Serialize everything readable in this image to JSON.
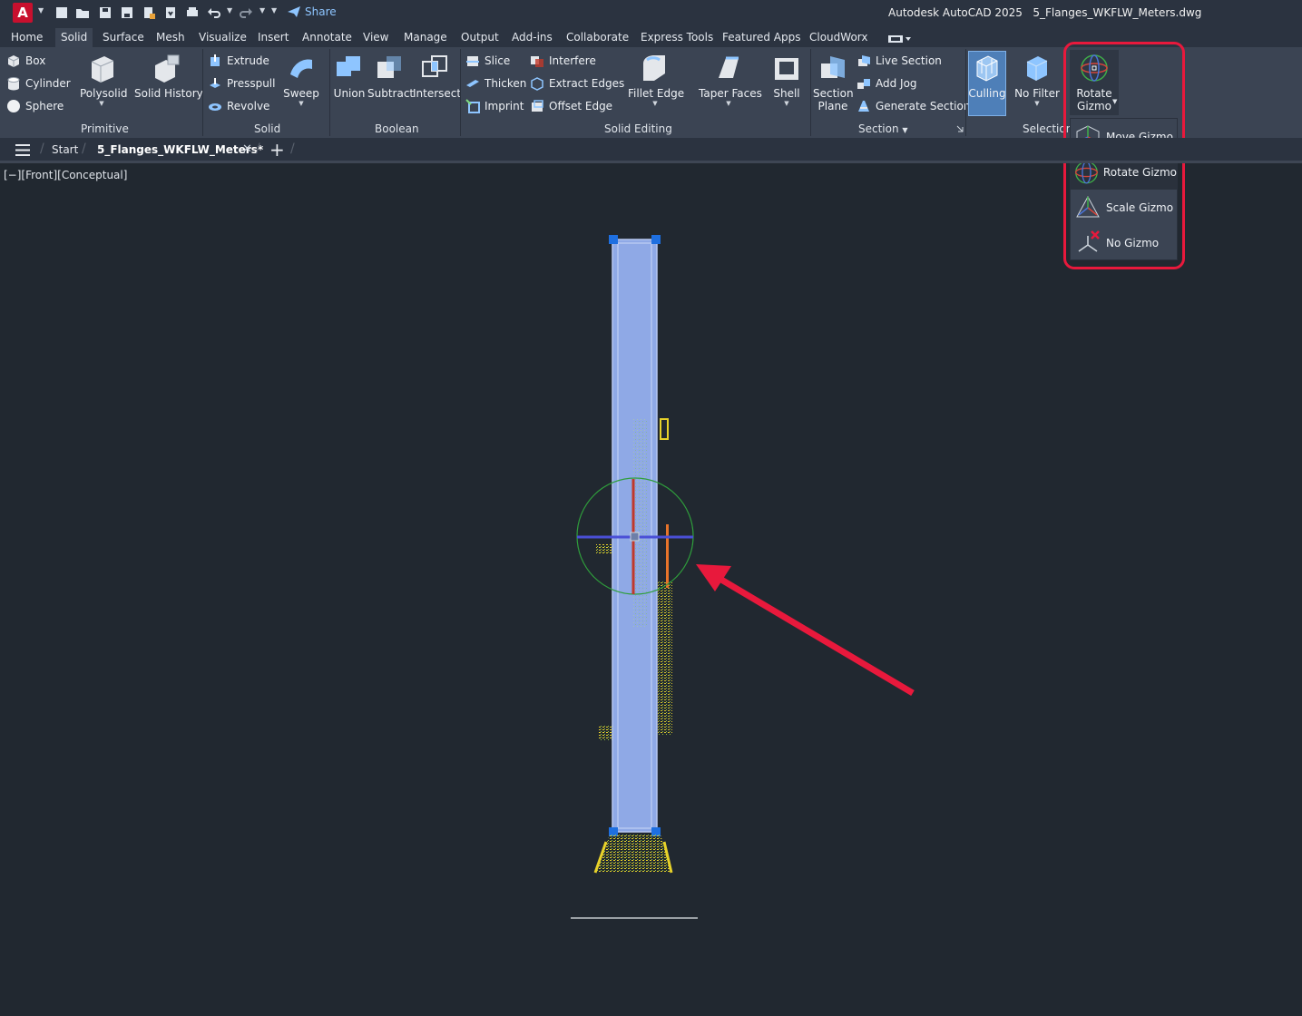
{
  "app": {
    "logo": "A",
    "title": "Autodesk AutoCAD 2025",
    "filename": "5_Flanges_WKFLW_Meters.dwg",
    "share_label": "Share"
  },
  "ribbon_tabs": [
    "Home",
    "Solid",
    "Surface",
    "Mesh",
    "Visualize",
    "Insert",
    "Annotate",
    "View",
    "Manage",
    "Output",
    "Add-ins",
    "Collaborate",
    "Express Tools",
    "Featured Apps",
    "CloudWorx"
  ],
  "active_tab": "Solid",
  "panels": {
    "primitive": {
      "title": "Primitive",
      "box": "Box",
      "cylinder": "Cylinder",
      "sphere": "Sphere",
      "polysolid": "Polysolid",
      "solid_history": "Solid History"
    },
    "solid": {
      "title": "Solid",
      "extrude": "Extrude",
      "presspull": "Presspull",
      "revolve": "Revolve",
      "sweep": "Sweep"
    },
    "boolean": {
      "title": "Boolean",
      "union": "Union",
      "subtract": "Subtract",
      "intersect": "Intersect"
    },
    "solid_editing": {
      "title": "Solid Editing",
      "slice": "Slice",
      "thicken": "Thicken",
      "imprint": "Imprint",
      "interfere": "Interfere",
      "extract_edges": "Extract Edges",
      "offset_edge": "Offset Edge",
      "fillet_edge": "Fillet Edge",
      "taper_faces": "Taper Faces",
      "shell": "Shell"
    },
    "section": {
      "title": "Section",
      "section_plane_1": "Section",
      "section_plane_2": "Plane",
      "live_section": "Live Section",
      "add_jog": "Add Jog",
      "generate_section": "Generate Section"
    },
    "selection": {
      "title": "Selection",
      "culling": "Culling",
      "no_filter": "No Filter",
      "gizmo_1": "Rotate",
      "gizmo_2": "Gizmo"
    }
  },
  "gizmo_menu": [
    "Move Gizmo",
    "Rotate Gizmo",
    "Scale Gizmo",
    "No Gizmo"
  ],
  "gizmo_selected": "Rotate Gizmo",
  "file_tabs": {
    "start": "Start",
    "active": "5_Flanges_WKFLW_Meters*"
  },
  "viewport_label": "[−][Front][Conceptual]",
  "colors": {
    "accent_red": "#e8193c",
    "ribbon": "#3b4453",
    "viewport": "#212830",
    "selection_blue": "#8fa9e6"
  }
}
